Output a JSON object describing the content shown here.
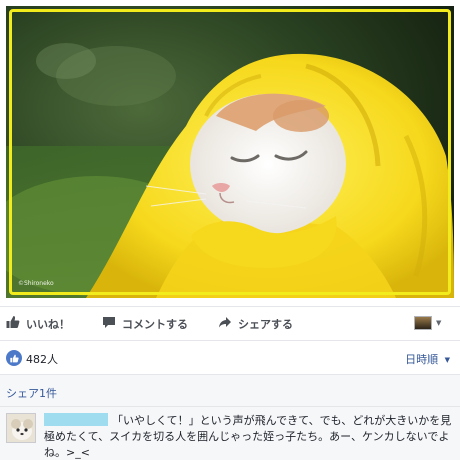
{
  "photo": {
    "watermark": "©Shironeko"
  },
  "actions": {
    "like": "いいね！",
    "comment": "コメントする",
    "share": "シェアする"
  },
  "icons": {
    "like": "thumbs-up-icon",
    "comment": "speech-bubble-icon",
    "share": "share-arrow-icon",
    "audience": "audience-thumbnail-icon",
    "chevron": "chevron-down-icon"
  },
  "reactions": {
    "count": "482人",
    "sort_label": "日時順"
  },
  "shares": {
    "label": "シェア1件"
  },
  "comment": {
    "text": "「いやしくて！」という声が飛んできて、でも、どれが大きいかを見極めたくて、スイカを切る人を囲んじゃった姪っ子たち。あー、ケンカしないでよね。>_<"
  },
  "colors": {
    "link": "#365899",
    "like_bubble": "#4d79c9",
    "frame": "#f3ec1d",
    "redaction": "#9fdcf0"
  }
}
